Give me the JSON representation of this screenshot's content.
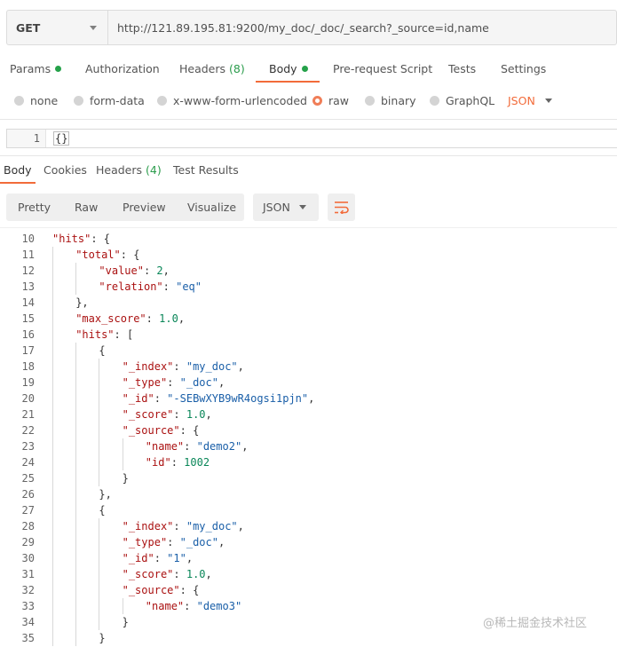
{
  "request": {
    "method": "GET",
    "url": "http://121.89.195.81:9200/my_doc/_doc/_search?_source=id,name"
  },
  "request_tabs": [
    {
      "label": "Params",
      "dot": true
    },
    {
      "label": "Authorization"
    },
    {
      "label": "Headers",
      "count": "(8)"
    },
    {
      "label": "Body",
      "dot": true,
      "active": true
    },
    {
      "label": "Pre-request Script"
    },
    {
      "label": "Tests"
    },
    {
      "label": "Settings"
    }
  ],
  "body_types": [
    {
      "label": "none"
    },
    {
      "label": "form-data"
    },
    {
      "label": "x-www-form-urlencoded"
    },
    {
      "label": "raw",
      "selected": true
    },
    {
      "label": "binary"
    },
    {
      "label": "GraphQL"
    }
  ],
  "body_format": "JSON",
  "request_editor": {
    "line_number": "1",
    "code": "{}"
  },
  "response_tabs": [
    {
      "label": "Body",
      "active": true
    },
    {
      "label": "Cookies"
    },
    {
      "label": "Headers",
      "count": "(4)"
    },
    {
      "label": "Test Results"
    }
  ],
  "view_modes": [
    "Pretty",
    "Raw",
    "Preview",
    "Visualize"
  ],
  "response_format": "JSON",
  "wrap_icon": "wrap-lines-icon",
  "response_lines": [
    {
      "n": "10",
      "indent": 1,
      "parts": [
        [
          "k",
          "\"hits\""
        ],
        [
          "p",
          ": {"
        ]
      ]
    },
    {
      "n": "11",
      "indent": 2,
      "parts": [
        [
          "k",
          "\"total\""
        ],
        [
          "p",
          ": {"
        ]
      ]
    },
    {
      "n": "12",
      "indent": 3,
      "parts": [
        [
          "k",
          "\"value\""
        ],
        [
          "p",
          ": "
        ],
        [
          "n",
          "2"
        ],
        [
          "p",
          ","
        ]
      ]
    },
    {
      "n": "13",
      "indent": 3,
      "parts": [
        [
          "k",
          "\"relation\""
        ],
        [
          "p",
          ": "
        ],
        [
          "s",
          "\"eq\""
        ]
      ]
    },
    {
      "n": "14",
      "indent": 2,
      "parts": [
        [
          "p",
          "},"
        ]
      ]
    },
    {
      "n": "15",
      "indent": 2,
      "parts": [
        [
          "k",
          "\"max_score\""
        ],
        [
          "p",
          ": "
        ],
        [
          "n",
          "1.0"
        ],
        [
          "p",
          ","
        ]
      ]
    },
    {
      "n": "16",
      "indent": 2,
      "parts": [
        [
          "k",
          "\"hits\""
        ],
        [
          "p",
          ": ["
        ]
      ]
    },
    {
      "n": "17",
      "indent": 3,
      "parts": [
        [
          "p",
          "{"
        ]
      ]
    },
    {
      "n": "18",
      "indent": 4,
      "parts": [
        [
          "k",
          "\"_index\""
        ],
        [
          "p",
          ": "
        ],
        [
          "s",
          "\"my_doc\""
        ],
        [
          "p",
          ","
        ]
      ]
    },
    {
      "n": "19",
      "indent": 4,
      "parts": [
        [
          "k",
          "\"_type\""
        ],
        [
          "p",
          ": "
        ],
        [
          "s",
          "\"_doc\""
        ],
        [
          "p",
          ","
        ]
      ]
    },
    {
      "n": "20",
      "indent": 4,
      "parts": [
        [
          "k",
          "\"_id\""
        ],
        [
          "p",
          ": "
        ],
        [
          "s",
          "\"-SEBwXYB9wR4ogsi1pjn\""
        ],
        [
          "p",
          ","
        ]
      ]
    },
    {
      "n": "21",
      "indent": 4,
      "parts": [
        [
          "k",
          "\"_score\""
        ],
        [
          "p",
          ": "
        ],
        [
          "n",
          "1.0"
        ],
        [
          "p",
          ","
        ]
      ]
    },
    {
      "n": "22",
      "indent": 4,
      "parts": [
        [
          "k",
          "\"_source\""
        ],
        [
          "p",
          ": {"
        ]
      ]
    },
    {
      "n": "23",
      "indent": 5,
      "parts": [
        [
          "k",
          "\"name\""
        ],
        [
          "p",
          ": "
        ],
        [
          "s",
          "\"demo2\""
        ],
        [
          "p",
          ","
        ]
      ]
    },
    {
      "n": "24",
      "indent": 5,
      "parts": [
        [
          "k",
          "\"id\""
        ],
        [
          "p",
          ": "
        ],
        [
          "n",
          "1002"
        ]
      ]
    },
    {
      "n": "25",
      "indent": 4,
      "parts": [
        [
          "p",
          "}"
        ]
      ]
    },
    {
      "n": "26",
      "indent": 3,
      "parts": [
        [
          "p",
          "},"
        ]
      ]
    },
    {
      "n": "27",
      "indent": 3,
      "parts": [
        [
          "p",
          "{"
        ]
      ]
    },
    {
      "n": "28",
      "indent": 4,
      "parts": [
        [
          "k",
          "\"_index\""
        ],
        [
          "p",
          ": "
        ],
        [
          "s",
          "\"my_doc\""
        ],
        [
          "p",
          ","
        ]
      ]
    },
    {
      "n": "29",
      "indent": 4,
      "parts": [
        [
          "k",
          "\"_type\""
        ],
        [
          "p",
          ": "
        ],
        [
          "s",
          "\"_doc\""
        ],
        [
          "p",
          ","
        ]
      ]
    },
    {
      "n": "30",
      "indent": 4,
      "parts": [
        [
          "k",
          "\"_id\""
        ],
        [
          "p",
          ": "
        ],
        [
          "s",
          "\"1\""
        ],
        [
          "p",
          ","
        ]
      ]
    },
    {
      "n": "31",
      "indent": 4,
      "parts": [
        [
          "k",
          "\"_score\""
        ],
        [
          "p",
          ": "
        ],
        [
          "n",
          "1.0"
        ],
        [
          "p",
          ","
        ]
      ]
    },
    {
      "n": "32",
      "indent": 4,
      "parts": [
        [
          "k",
          "\"_source\""
        ],
        [
          "p",
          ": {"
        ]
      ]
    },
    {
      "n": "33",
      "indent": 5,
      "parts": [
        [
          "k",
          "\"name\""
        ],
        [
          "p",
          ": "
        ],
        [
          "s",
          "\"demo3\""
        ]
      ]
    },
    {
      "n": "34",
      "indent": 4,
      "parts": [
        [
          "p",
          "}"
        ]
      ]
    },
    {
      "n": "35",
      "indent": 3,
      "parts": [
        [
          "p",
          "}"
        ]
      ]
    }
  ],
  "watermark": "@稀土掘金技术社区"
}
